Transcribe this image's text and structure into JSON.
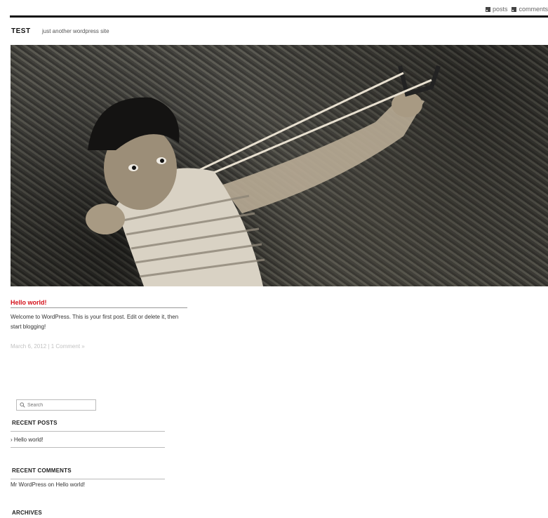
{
  "feeds": {
    "posts_label": "posts",
    "comments_label": "comments"
  },
  "site": {
    "title": "TEST",
    "description": "just another wordpress site"
  },
  "post": {
    "title": "Hello world!",
    "body": "Welcome to WordPress. This is your first post. Edit or delete it, then start blogging!",
    "date": "March 6, 2012",
    "separator": "|",
    "comments_link": "1 Comment »"
  },
  "sidebar": {
    "search_placeholder": "Search",
    "recent_posts": {
      "title": "RECENT POSTS",
      "items": [
        "Hello world!"
      ]
    },
    "recent_comments": {
      "title": "RECENT COMMENTS",
      "items": [
        {
          "author": "Mr WordPress",
          "connector": "on",
          "post": "Hello world!"
        }
      ]
    },
    "archives": {
      "title": "ARCHIVES"
    }
  },
  "colors": {
    "accent": "#d4111a",
    "meta": "#c2c2c2"
  }
}
